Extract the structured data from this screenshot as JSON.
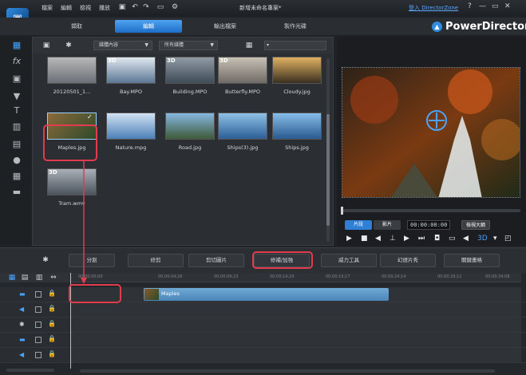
{
  "menu": {
    "items": [
      "檔案",
      "編輯",
      "檢視",
      "播放"
    ],
    "project_title": "新增未命名專案*",
    "login_link": "登入 DirectorZone",
    "help": "?",
    "minimize": "—",
    "restore": "▭",
    "close": "✕"
  },
  "modes": [
    {
      "label": "擷取",
      "active": false
    },
    {
      "label": "編輯",
      "active": true
    },
    {
      "label": "輸出檔案",
      "active": false
    },
    {
      "label": "製作光碟",
      "active": false
    }
  ],
  "brand": {
    "name": "PowerDirector"
  },
  "library": {
    "filter_dropdown": "媒體內容",
    "category_dropdown": "所有媒體",
    "items": [
      {
        "label": "20120501_1...",
        "is3d": false,
        "thumb_colors": [
          "#b8b8b8",
          "#6b6f76"
        ]
      },
      {
        "label": "Bay.MPO",
        "is3d": true,
        "thumb_colors": [
          "#dfe7ee",
          "#5b7795"
        ]
      },
      {
        "label": "Building.MPO",
        "is3d": true,
        "thumb_colors": [
          "#8f9aa4",
          "#3f4b57"
        ]
      },
      {
        "label": "Butterfly.MPO",
        "is3d": true,
        "thumb_colors": [
          "#c8c0b4",
          "#6f6a66"
        ]
      },
      {
        "label": "Cloudy.jpg",
        "is3d": false,
        "thumb_colors": [
          "#e0b060",
          "#3a3020"
        ]
      },
      {
        "label": "Maples.jpg",
        "is3d": false,
        "thumb_colors": [
          "#8b6a3b",
          "#2d4a2a"
        ]
      },
      {
        "label": "Nature.mpg",
        "is3d": false,
        "thumb_colors": [
          "#d2e2f2",
          "#4b7fb8"
        ]
      },
      {
        "label": "Road.jpg",
        "is3d": false,
        "thumb_colors": [
          "#87b7e0",
          "#3d5a3a"
        ]
      },
      {
        "label": "Ships(3).jpg",
        "is3d": false,
        "thumb_colors": [
          "#8fc0e6",
          "#2b5f96"
        ]
      },
      {
        "label": "Ships.jpg",
        "is3d": false,
        "thumb_colors": [
          "#86bde8",
          "#2a5a90"
        ]
      },
      {
        "label": "Tram.wmv",
        "is3d": true,
        "thumb_colors": [
          "#a9b0b8",
          "#4b535c"
        ]
      }
    ]
  },
  "preview": {
    "mode_clip": "片段",
    "mode_movie": "影片",
    "timecode": "00:00:00:00",
    "quality": "檢視大綱"
  },
  "tools": {
    "split": "分割",
    "trim": "修剪",
    "crop": "剪切圖片",
    "fix_enhance": "修補/加強",
    "power_tools": "威力工具",
    "slideshow": "幻燈片秀",
    "keyframe": "關鍵畫格"
  },
  "timeline": {
    "ruler": [
      "00;00;00;00",
      "00;00;04;26",
      "00;00;09;23",
      "00;00;14;20",
      "00;00;19;17",
      "00;00;24;14",
      "00;00;29;11",
      "00;00;34;08"
    ],
    "clip_label": "Maples"
  }
}
